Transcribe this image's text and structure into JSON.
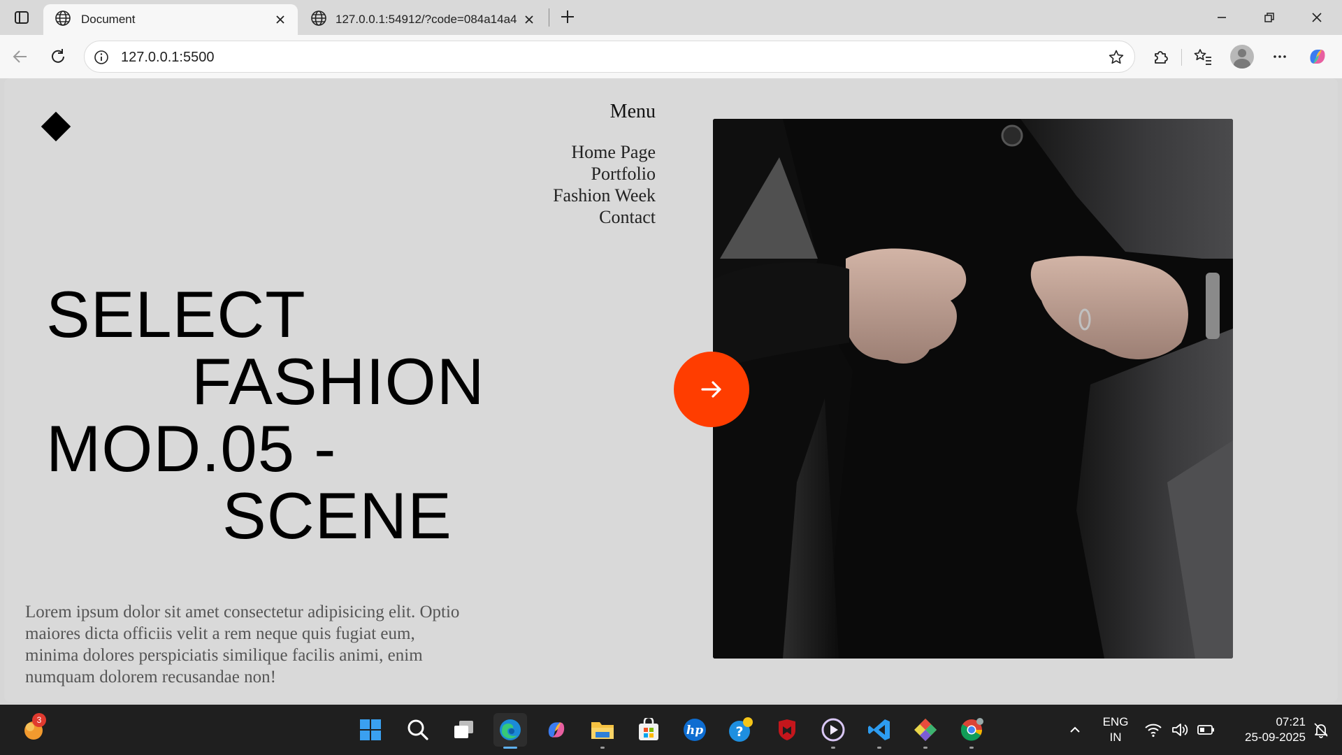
{
  "browser": {
    "tabs": [
      {
        "title": "Document",
        "active": true
      },
      {
        "title": "127.0.0.1:54912/?code=084a14a4",
        "active": false
      }
    ],
    "address": "127.0.0.1:5500"
  },
  "page": {
    "menu_title": "Menu",
    "menu_items": [
      "Home Page",
      "Portfolio",
      "Fashion Week",
      "Contact"
    ],
    "headline": [
      "SELECT",
      "FASHION",
      "MOD.05 -",
      "SCENE"
    ],
    "intro": "Lorem ipsum dolor sit amet consectetur adipisicing elit. Optio maiores dicta officiis velit a rem neque quis fugiat eum, minima dolores perspiciatis similique facilis animi, enim numquam dolorem recusandae non!",
    "accent_color": "#ff3d00",
    "hero_image_icon": "fashion-photo"
  },
  "taskbar": {
    "notification_count": "3",
    "language": "ENG",
    "region": "IN",
    "time": "07:21",
    "date": "25-09-2025"
  }
}
